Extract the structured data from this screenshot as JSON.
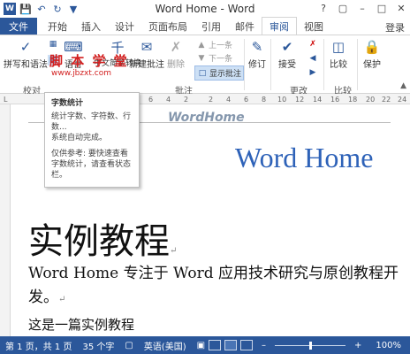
{
  "window": {
    "title": "Word Home - Word"
  },
  "qat": {
    "save_icon": "save-icon",
    "undo_icon": "undo-icon",
    "redo_icon": "redo-icon"
  },
  "tabs": [
    "文件",
    "开始",
    "插入",
    "设计",
    "页面布局",
    "引用",
    "邮件",
    "审阅",
    "视图"
  ],
  "active_tab": "审阅",
  "account": {
    "login_label": "登录"
  },
  "ribbon": {
    "spelling": "拼写和语法",
    "language": "语言",
    "chinese_convert": "中文简繁转换",
    "new_comment": "新建批注",
    "delete": "删除",
    "prev": "上一条",
    "next": "下一条",
    "show_comments": "显示批注",
    "track": "修订",
    "accept": "接受",
    "compare": "比较",
    "protect": "保护",
    "group_proofing": "校对",
    "group_comments": "批注",
    "group_changes": "更改",
    "group_compare": "比较",
    "watermark": "脚 本 学 堂",
    "watermark_url": "www.jbzxt.com"
  },
  "ruler": {
    "marks": [
      "L",
      "6",
      "4",
      "2",
      "2",
      "4",
      "6",
      "8",
      "10",
      "12",
      "14",
      "16",
      "18",
      "20",
      "22",
      "24"
    ]
  },
  "tooltip": {
    "title": "字数统计",
    "body1": "统计字数、字符数、行数...",
    "body2": "系统自动完成。",
    "body3": "仅供参考: 要快速查看字数统计，请查看状态栏。"
  },
  "document": {
    "header": "WordHome",
    "big_blue": "Word Home",
    "heading": "实例教程",
    "para": "Word Home 专注于 Word 应用技术研究与原创教程开发。",
    "para2": "这是一篇实例教程"
  },
  "status": {
    "page": "第 1 页，共 1 页",
    "words": "35 个字",
    "language": "英语(美国)",
    "zoom": "100%",
    "zoom_level": 0.5
  },
  "colors": {
    "accent": "#2b579a",
    "heading_blue": "#2e62b8",
    "watermark_red": "#d21f1f"
  }
}
